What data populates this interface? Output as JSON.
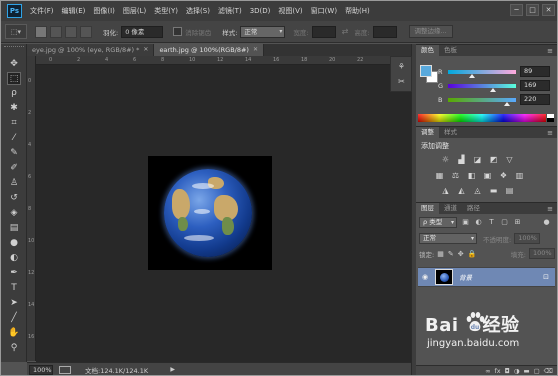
{
  "app": {
    "logo": "Ps",
    "menu": [
      "文件(F)",
      "编辑(E)",
      "图像(I)",
      "图层(L)",
      "类型(Y)",
      "选择(S)",
      "滤镜(T)",
      "3D(D)",
      "视图(V)",
      "窗口(W)",
      "帮助(H)"
    ],
    "window_controls": [
      "─",
      "□",
      "✕"
    ]
  },
  "options_bar": {
    "feather_label": "羽化:",
    "feather_value": "0 像素",
    "antialias_label": "消除锯齿",
    "style_label": "样式:",
    "style_value": "正常",
    "width_label": "宽度:",
    "height_label": "高度:",
    "refine_edge_label": "调整边缘..."
  },
  "documents": [
    {
      "title": "eye.jpg @ 100% (eye, RGB/8#) *",
      "active": false
    },
    {
      "title": "earth.jpg @ 100%(RGB/8#)",
      "active": true
    }
  ],
  "rulers": {
    "top": [
      "0",
      "2",
      "4",
      "6",
      "8",
      "10",
      "12",
      "14",
      "16",
      "18",
      "20",
      "22"
    ],
    "left": [
      "0",
      "2",
      "4",
      "6",
      "8",
      "10",
      "12",
      "14",
      "16"
    ]
  },
  "status_bar": {
    "zoom": "100%",
    "doc_info": "文档:124.1K/124.1K",
    "arrow": "▶"
  },
  "color_panel": {
    "tabs": [
      "颜色",
      "色板"
    ],
    "foreground_color": "#59a9dc",
    "background_color": "#ffffff",
    "channels": [
      {
        "label": "R",
        "value": "89"
      },
      {
        "label": "G",
        "value": "169"
      },
      {
        "label": "B",
        "value": "220"
      }
    ]
  },
  "adjustments_panel": {
    "tabs": [
      "调整",
      "样式"
    ],
    "title": "添加调整",
    "row1_icons": [
      "brightness-icon",
      "levels-icon",
      "curves-icon",
      "exposure-icon",
      "vibrance-icon"
    ],
    "row2_icons": [
      "hue-saturation-icon",
      "color-balance-icon",
      "black-white-icon",
      "photo-filter-icon",
      "channel-mixer-icon",
      "color-lookup-icon"
    ],
    "row3_icons": [
      "invert-icon",
      "posterize-icon",
      "threshold-icon",
      "gradient-map-icon",
      "selective-color-icon"
    ]
  },
  "layers_panel": {
    "tabs": [
      "图层",
      "通道",
      "路径"
    ],
    "filter_kind": "ρ 类型",
    "blend_mode": "正常",
    "opacity_label": "不透明度:",
    "opacity_value": "100%",
    "lock_label": "锁定:",
    "fill_label": "填充:",
    "fill_value": "100%",
    "layers": [
      {
        "name": "背景",
        "visible": true,
        "locked": true
      }
    ],
    "footer_icons": [
      "link-icon",
      "fx-icon",
      "mask-icon",
      "adjustment-icon",
      "group-icon",
      "new-layer-icon",
      "delete-icon"
    ]
  },
  "watermark": {
    "logo_left": "Bai",
    "logo_right": "经验",
    "url": "jingyan.baidu.com"
  }
}
